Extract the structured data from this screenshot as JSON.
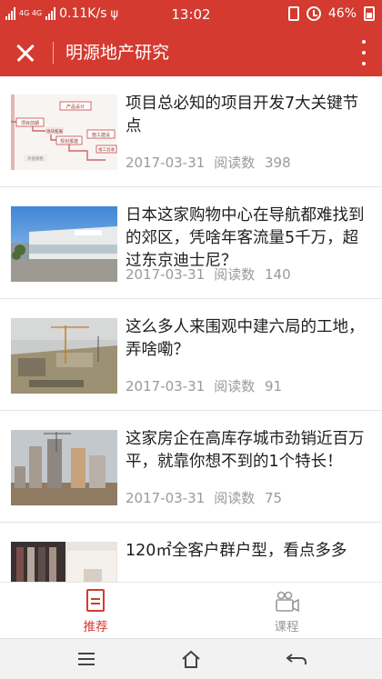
{
  "status_bar": {
    "network_label": "4G 4G",
    "speed": "0.11K/s",
    "time": "13:02",
    "battery": "46%"
  },
  "app_bar": {
    "title": "明源地产研究"
  },
  "thumb_texts": {
    "item0": [
      "产品设计",
      "项目前期",
      "地块拓展",
      "规划报建",
      "施工建设",
      "竣工验收",
      "开盘销售"
    ]
  },
  "articles": [
    {
      "title": "项目总必知的项目开发7大关键节点",
      "date": "2017-03-31",
      "reads_label": "阅读数",
      "reads": "398"
    },
    {
      "title": "日本这家购物中心在导航都难找到的郊区，凭啥年客流量5千万，超过东京迪士尼？",
      "date": "2017-03-31",
      "reads_label": "阅读数",
      "reads": "140"
    },
    {
      "title": "这么多人来围观中建六局的工地，弄啥嘞？",
      "date": "2017-03-31",
      "reads_label": "阅读数",
      "reads": "91"
    },
    {
      "title": "这家房企在高库存城市劲销近百万平，就靠你想不到的1个特长！",
      "date": "2017-03-31",
      "reads_label": "阅读数",
      "reads": "75"
    },
    {
      "title": "120㎡全客户群户型，看点多多",
      "date": "",
      "reads_label": "",
      "reads": ""
    }
  ],
  "tabs": [
    {
      "label": "推荐",
      "icon": "document-icon",
      "active": true
    },
    {
      "label": "课程",
      "icon": "video-camera-icon",
      "active": false
    }
  ],
  "colors": {
    "brand_red": "#d43a2f",
    "text_dark": "#1e1e1e",
    "text_gray": "#9a9a9a"
  }
}
